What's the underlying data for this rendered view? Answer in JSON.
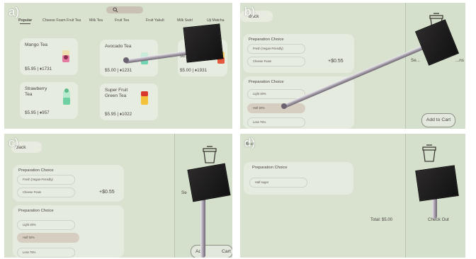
{
  "panels": {
    "a": {
      "label": "a)",
      "categories": [
        "Popular",
        "Cheese Foam Fruit Tea",
        "Milk Tea",
        "Fruit Tea",
        "Fruit Yakult",
        "Milk Swirl",
        "Uji Matcha"
      ],
      "products": [
        {
          "name": "Mango Tea",
          "price": "$5.95 | ♦1731"
        },
        {
          "name": "Avocado Tea",
          "price": "$5.00 | ♦1231"
        },
        {
          "name": "Mi...",
          "price": "$5.00 | ♦1931"
        },
        {
          "name": "Strawberry\nTea",
          "price": "$5.95 | ♦957"
        },
        {
          "name": "Super Fruit\nGreen Tea",
          "price": "$5.95 | ♦1022"
        }
      ]
    },
    "b": {
      "label": "b)",
      "back_label": "Back",
      "section1_title": "Preparation Choice",
      "section1_options": [
        "Fresh (Vegan-Friendly)",
        "Cheese Foam"
      ],
      "section1_price": "+$0.55",
      "section2_title": "Preparation Choice",
      "section2_options": [
        "Light 30%",
        "Half 50%",
        "Less 75%"
      ],
      "side_text": "Se...",
      "side_text_right": "...ns",
      "add_to_cart": "Add to Cart"
    },
    "c": {
      "label": "c)",
      "back_label": "Back",
      "section1_title": "Preparation Choice",
      "section1_options": [
        "Fresh (Vegan-Friendly)",
        "Cheese Foam"
      ],
      "section1_price": "+$0.55",
      "section2_title": "Preparation Choice",
      "section2_options": [
        "Light 30%",
        "Half 50%",
        "Less 75%"
      ],
      "side_text": "Se",
      "add_to_cart_left": "Add",
      "add_to_cart_right": "Cart"
    },
    "d": {
      "label": "d)",
      "back_label": "Back",
      "cart_item_title": "Preparation Choice",
      "cart_item_option": "Half sugar",
      "total": "Total: $5.00",
      "checkout": "Check Out"
    }
  },
  "colors": {
    "screen_bg": "#d8e2cf",
    "card_bg": "#e6ece0",
    "selected_pill": "#d6cec0",
    "device": "#1a1919"
  }
}
